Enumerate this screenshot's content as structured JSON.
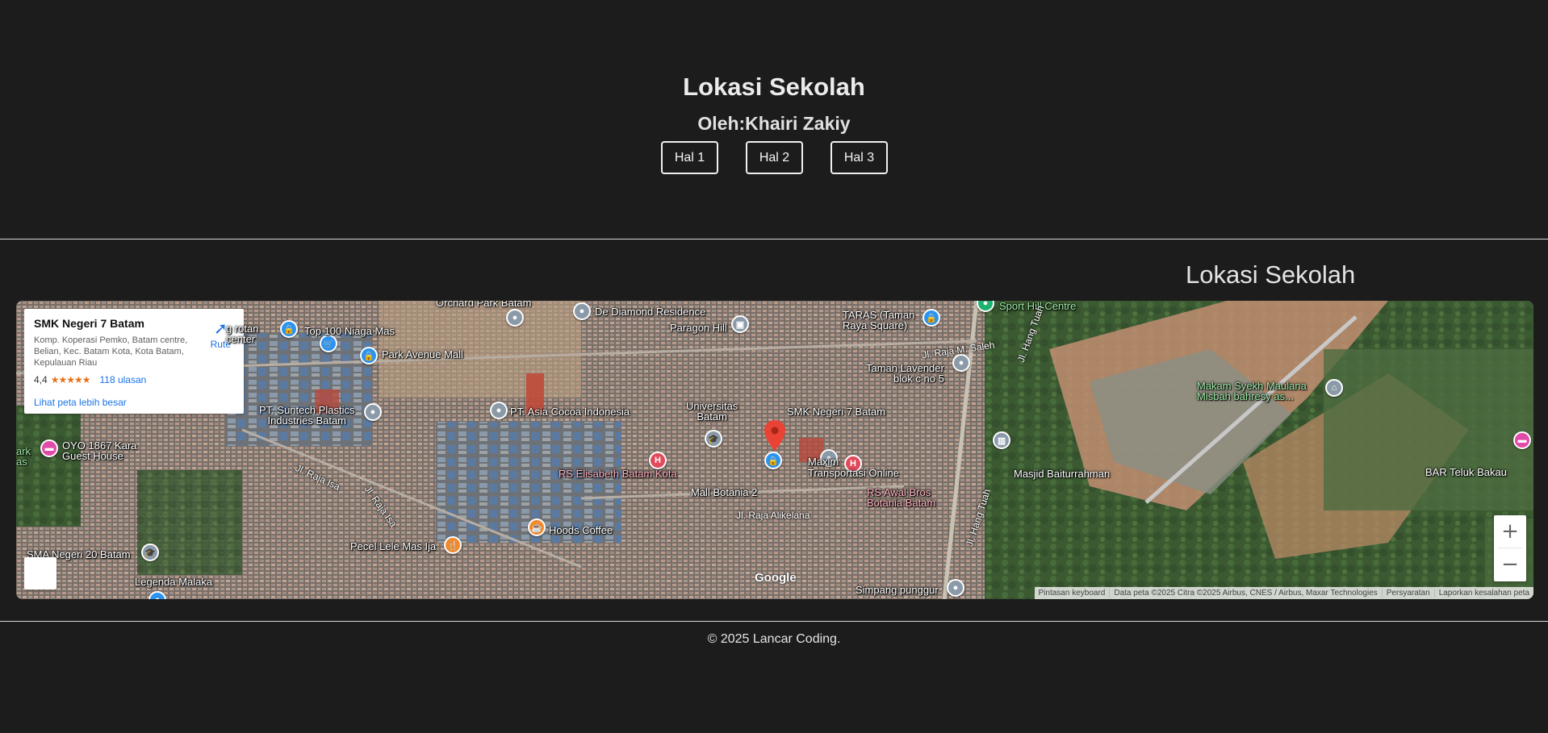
{
  "header": {
    "title": "Lokasi Sekolah",
    "subtitle": "Oleh:Khairi Zakiy",
    "nav": [
      "Hal 1",
      "Hal 2",
      "Hal 3"
    ]
  },
  "section": {
    "title": "Lokasi Sekolah"
  },
  "map": {
    "card": {
      "name": "SMK Negeri 7 Batam",
      "address": "Komp. Koperasi Pemko, Batam centre, Belian, Kec. Batam Kota, Kota Batam, Kepulauan Riau",
      "rating": "4,4",
      "stars": "★★★★★",
      "reviews": "118 ulasan",
      "route": "Rute",
      "larger_map": "Lihat peta lebih besar"
    },
    "places": {
      "orchard": "Orchard Park Batam",
      "diamond": "De Diamond Residence",
      "taras": "TARAS (Taman\nRaya Square)",
      "sporthill": "Sport Hill Centre",
      "rotan": "g rotan\ncenter",
      "niaga": "Top 100 Niaga Mas",
      "paragon": "Paragon Hill",
      "rajasaleh": "Jl. Raja M. Saleh",
      "hangtuah1": "Jl. Hang Tuah",
      "park": "Park Avenue Mall",
      "lavender": "Taman Lavender\nblok c no 5",
      "makam": "Makam Syekh Maulana\nMisbah bahresy as...",
      "suntech": "PT. Suntech Plastics\nIndustries Batam",
      "cocoa": "PT. Asia Cocoa Indonesia",
      "univ": "Universitas\nBatam",
      "smk": "SMK Negeri 7 Batam",
      "oyo": "OYO 1867 Kara\nGuest House",
      "ark": "ark\nas",
      "rajaisa1": "Jl. Raja Isa",
      "rajaisa2": "Jl. Raja Isa",
      "rselisabeth": "RS Elisabeth Batam Kota",
      "maxim": "Maxim\nTransportasi Online",
      "masjid": "Masjid Baiturrahman",
      "barteluk": "BAR Teluk Bakau",
      "botania": "Mall Botania 2",
      "rsawal": "RS Awal Bros\nBotania Batam",
      "alikelana": "Jl. Raja Alikelana",
      "hoods": "Hoods Coffee",
      "lele": "Pecel Lele Mas Ija",
      "hangtuah2": "Jl. Hang Tuah",
      "sma": "SMA Negeri 20 Batam",
      "legenda": "Legenda Malaka",
      "simpang": "Simpang punggur",
      "edge_r": "R"
    },
    "google": "Google",
    "attribution": [
      "Pintasan keyboard",
      "Data peta ©2025 Citra ©2025 Airbus, CNES / Airbus, Maxar Technologies",
      "Persyaratan",
      "Laporkan kesalahan peta"
    ],
    "zoom_in": "+",
    "zoom_out": "−"
  },
  "footer": {
    "text": "© 2025 Lancar Coding."
  }
}
